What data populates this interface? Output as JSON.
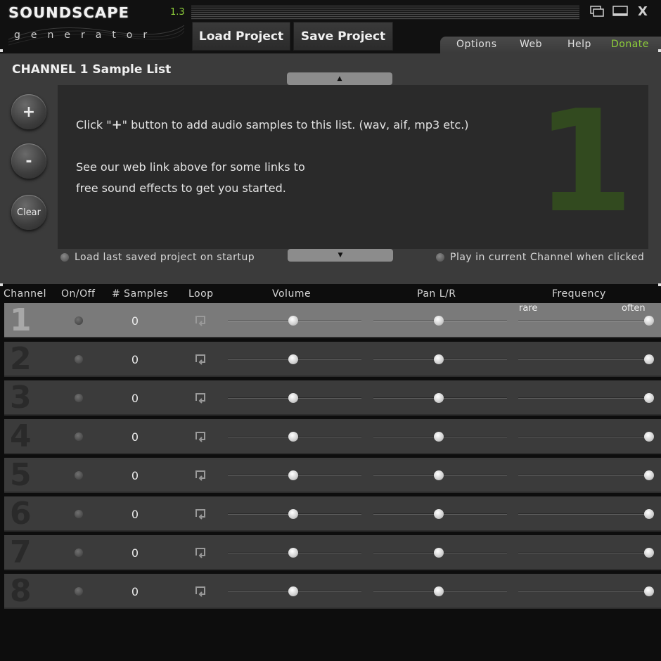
{
  "app": {
    "logo_main": "SOUNDSCAPE",
    "logo_version": "1.3",
    "logo_sub": "generator"
  },
  "toolbar": {
    "load_label": "Load Project",
    "save_label": "Save Project",
    "close_label": "X"
  },
  "menu": {
    "options": "Options",
    "web": "Web",
    "help": "Help",
    "donate": "Donate"
  },
  "sample_list": {
    "title": "CHANNEL 1 Sample List",
    "add_label": "+",
    "remove_label": "-",
    "clear_label": "Clear",
    "hint_prefix": "Click \"",
    "hint_plus": "+",
    "hint_suffix": "\" button  to add audio samples to this list. (wav, aif, mp3 etc.)",
    "hint_line2": "See our web link above for some links to",
    "hint_line3": "free sound effects to get you started.",
    "big_channel": "1",
    "load_last_label": "Load last saved project on startup",
    "play_current_label": "Play in current Channel when clicked"
  },
  "table": {
    "headers": {
      "channel": "Channel",
      "onoff": "On/Off",
      "samples": "# Samples",
      "loop": "Loop",
      "volume": "Volume",
      "pan": "Pan L/R",
      "frequency": "Frequency"
    },
    "freq_rare": "rare",
    "freq_often": "often",
    "active_channel": 1,
    "rows": [
      {
        "num": "1",
        "samples": "0",
        "volume": 0.49,
        "pan": 0.49,
        "frequency": 1.0
      },
      {
        "num": "2",
        "samples": "0",
        "volume": 0.49,
        "pan": 0.49,
        "frequency": 1.0
      },
      {
        "num": "3",
        "samples": "0",
        "volume": 0.49,
        "pan": 0.49,
        "frequency": 1.0
      },
      {
        "num": "4",
        "samples": "0",
        "volume": 0.49,
        "pan": 0.49,
        "frequency": 1.0
      },
      {
        "num": "5",
        "samples": "0",
        "volume": 0.49,
        "pan": 0.49,
        "frequency": 1.0
      },
      {
        "num": "6",
        "samples": "0",
        "volume": 0.49,
        "pan": 0.49,
        "frequency": 1.0
      },
      {
        "num": "7",
        "samples": "0",
        "volume": 0.49,
        "pan": 0.49,
        "frequency": 1.0
      },
      {
        "num": "8",
        "samples": "0",
        "volume": 0.49,
        "pan": 0.49,
        "frequency": 1.0
      }
    ]
  },
  "colors": {
    "accent_green": "#8ecf3a",
    "big_number": "#324a1f",
    "panel": "#3b3b3b",
    "active_row": "#7a7a7a"
  }
}
